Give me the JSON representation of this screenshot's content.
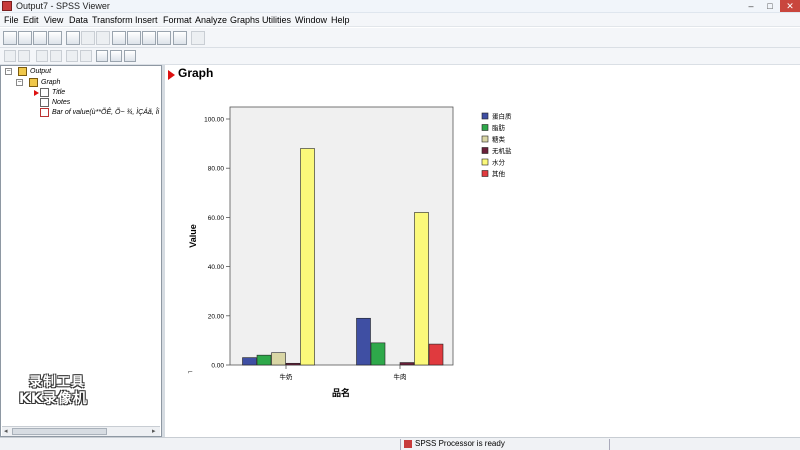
{
  "window": {
    "title": "Output7 - SPSS Viewer"
  },
  "menu": [
    "File",
    "Edit",
    "View",
    "Data",
    "Transform",
    "Insert",
    "Format",
    "Analyze",
    "Graphs",
    "Utilities",
    "Window",
    "Help"
  ],
  "tree": {
    "root": "Output",
    "group": "Graph",
    "items": [
      "Title",
      "Notes",
      "Bar of value(ù**ÕÊ, Õ~ ¾, ÌÇÁã, Îi­"
    ]
  },
  "content": {
    "heading": "Graph"
  },
  "watermark": {
    "line1": "录制工具",
    "line2": "KK录像机"
  },
  "status": {
    "text": "SPSS Processor  is ready"
  },
  "colors": {
    "accent": "#dd1111",
    "chart_bg": "#f0f0f0"
  },
  "chart_data": {
    "type": "bar",
    "xlabel": "品名",
    "ylabel": "Value",
    "categories": [
      "牛奶",
      "牛肉"
    ],
    "ylim": [
      0,
      100
    ],
    "yticks": [
      "0.00",
      "20.00",
      "40.00",
      "60.00",
      "80.00",
      "100.00"
    ],
    "legend_position": "right",
    "series": [
      {
        "name": "蛋白质",
        "color": "#3f4fa3",
        "values": [
          3.0,
          19.0
        ]
      },
      {
        "name": "脂肪",
        "color": "#2ea84a",
        "values": [
          4.0,
          9.0
        ]
      },
      {
        "name": "糖类",
        "color": "#d9d6a5",
        "values": [
          5.0,
          0.0
        ]
      },
      {
        "name": "无机盐",
        "color": "#6b1f3a",
        "values": [
          0.7,
          1.0
        ]
      },
      {
        "name": "水分",
        "color": "#fbf97a",
        "values": [
          88.0,
          62.0
        ]
      },
      {
        "name": "其他",
        "color": "#e03a3e",
        "values": [
          0.0,
          8.5
        ]
      }
    ]
  }
}
